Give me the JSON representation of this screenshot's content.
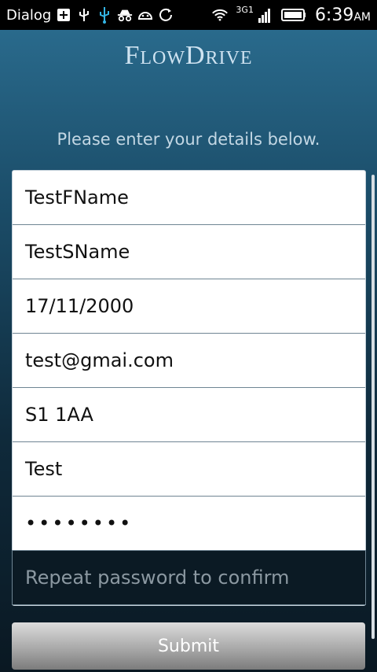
{
  "status_bar": {
    "carrier": "Dialog",
    "network_label": "3G",
    "network_sup": "1",
    "time": "6:39",
    "ampm": "AM",
    "icons": [
      "plus-icon",
      "usb-trident-icon",
      "usb-icon",
      "incognito-icon",
      "android-icon",
      "sync-icon",
      "wifi-icon",
      "signal-icon",
      "battery-icon"
    ]
  },
  "header": {
    "brand": "FlowDrive",
    "subtitle": "Please enter your details below."
  },
  "form": {
    "first_name": "TestFName",
    "surname": "TestSName",
    "dob": "17/11/2000",
    "email": "test@gmai.com",
    "postcode": "S1 1AA",
    "town": "Test",
    "password": "••••••••",
    "repeat_password_placeholder": "Repeat password to confirm"
  },
  "actions": {
    "submit_label": "Submit"
  },
  "colors": {
    "background_top": "#2c6f92",
    "background_bottom": "#0a1822",
    "status_bar": "#000000",
    "field_border": "#6f8593",
    "submit_gradient_top": "#dcdcdc",
    "submit_gradient_bottom": "#7c7c7c"
  }
}
